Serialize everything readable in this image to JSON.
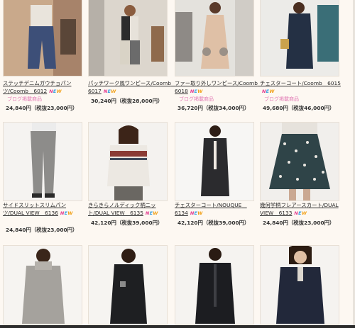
{
  "products": [
    {
      "name": "ステッチデニムガウチョパンツ/Coomb　6012",
      "new": true,
      "blog": "ブログ掲載商品",
      "price": "24,840円（税抜23,000円）"
    },
    {
      "name": "パッチワーク風ワンピース/Coomb　6017",
      "new": true,
      "blog": "",
      "price": "30,240円（税抜28,000円）"
    },
    {
      "name": "ファー取り外しワンピース/Coomb　6018",
      "new": true,
      "blog": "ブログ掲載商品",
      "price": "36,720円（税抜34,000円）"
    },
    {
      "name": "チェスターコート/Coomb　6015",
      "new": true,
      "blog": "ブログ掲載商品",
      "price": "49,680円（税抜46,000円）"
    },
    {
      "name": "サイドスリットスリムパンツ/DUAL VIEW　6136",
      "new": true,
      "blog": "",
      "price": "24,840円（税抜23,000円）"
    },
    {
      "name": "きらきらノルディック柄ニット/DUAL VIEW　6135",
      "new": true,
      "blog": "",
      "price": "42,120円（税抜39,000円）"
    },
    {
      "name": "チェスターコート/NOUQUE　6134",
      "new": true,
      "blog": "",
      "price": "42,120円（税抜39,000円）"
    },
    {
      "name": "幾何学柄フレアースカート/DUAL VIEW　6133",
      "new": true,
      "blog": "",
      "price": "24,840円（税抜23,000円）"
    },
    {
      "name": "",
      "new": false,
      "blog": "",
      "price": ""
    },
    {
      "name": "",
      "new": false,
      "blog": "",
      "price": ""
    },
    {
      "name": "",
      "new": false,
      "blog": "",
      "price": ""
    },
    {
      "name": "",
      "new": false,
      "blog": "",
      "price": ""
    }
  ],
  "new_badge": {
    "n": "N",
    "e": "E",
    "w": "W"
  },
  "colors": {
    "blog": "#e27ab5",
    "new_n": "#e23b8f",
    "new_e": "#3a9fe0",
    "new_w": "#f2a21b"
  }
}
